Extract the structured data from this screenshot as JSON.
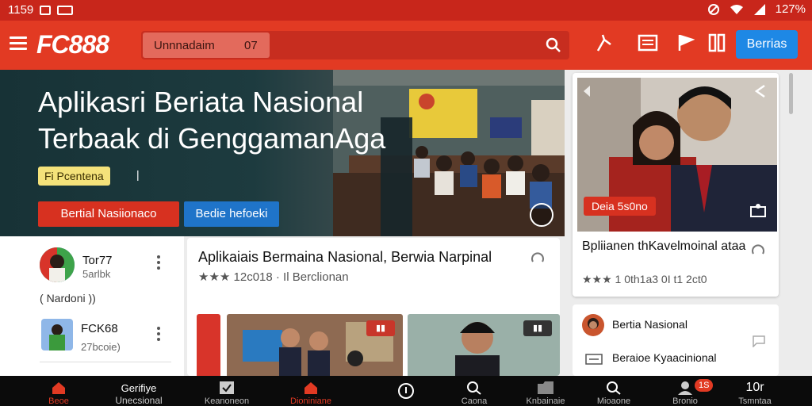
{
  "status_bar": {
    "time": "1159",
    "battery": "127%"
  },
  "app_bar": {
    "logo": "FC888",
    "search_value": "Unnnadaim",
    "search_count": "07",
    "berita_button": "Berrias"
  },
  "hero": {
    "title": "Aplikasri Beriata Nasional Terbaak di GenggamanAga",
    "tag": "Fi Pcentena",
    "button_primary": "Bertial Nasiionaco",
    "button_secondary": "Bedie hefoeki"
  },
  "featured_card": {
    "badge": "Deia 5s0no",
    "title": "Bpliianen thKavelmoinal ataa",
    "meta": "★★★ 1 0th1a3 0I t1 2ct0"
  },
  "left_list": {
    "item1_title": "Tor77",
    "item1_sub": "5arlbk",
    "item1_extra": "Nardoni ))",
    "item2_title": "FCK68",
    "item2_sub": "27bcoie)"
  },
  "middle_card": {
    "title": "Aplikaiais Bermaina Nasional, Berwia Narpinal",
    "meta": "★★★ 12c018 · Il Berclionan"
  },
  "right_list": {
    "item1": "Bertia Nasional",
    "item2": "Beraioe Kyaacinional"
  },
  "bottom_nav": {
    "item1": "Beoe",
    "item2_line1": "Gerifiye",
    "item2_line2": "Unecsional",
    "item3": "Keanoneon",
    "item4": "Dioniniane",
    "item5": "",
    "item6": "Caona",
    "item7": "Knbainaie",
    "item8": "Mioaone",
    "item9": "Bronio",
    "item9_badge": "1S",
    "item10_top": "10r",
    "item10": "Tsmntaa"
  }
}
